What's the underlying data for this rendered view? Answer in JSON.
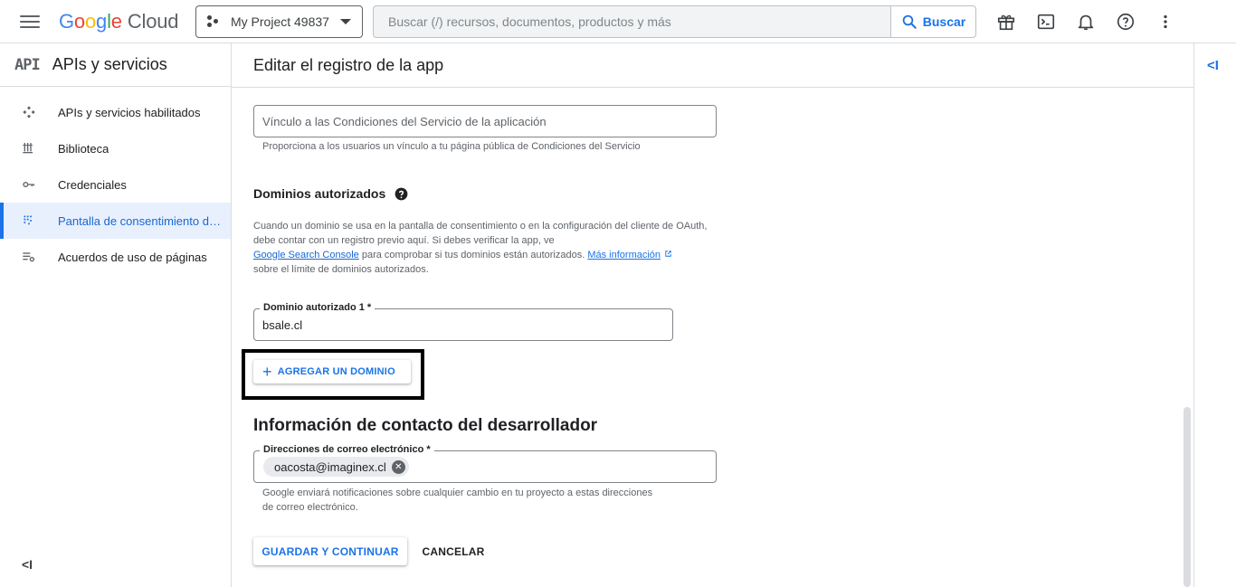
{
  "topbar": {
    "logo_letters": [
      "G",
      "o",
      "o",
      "g",
      "l",
      "e"
    ],
    "logo_suffix": "Cloud",
    "project_name": "My Project 49837",
    "search_placeholder": "Buscar (/) recursos, documentos, productos y más",
    "search_button": "Buscar",
    "icons": [
      "gift-icon",
      "terminal-icon",
      "bell-icon",
      "help-icon",
      "more-vert-icon"
    ]
  },
  "sidebar": {
    "logo_text": "API",
    "title": "APIs y servicios",
    "items": [
      {
        "label": "APIs y servicios habilitados",
        "icon": "apis-icon",
        "active": false
      },
      {
        "label": "Biblioteca",
        "icon": "library-icon",
        "active": false
      },
      {
        "label": "Credenciales",
        "icon": "key-icon",
        "active": false
      },
      {
        "label": "Pantalla de consentimiento de OAuth",
        "icon": "consent-icon",
        "active": true
      },
      {
        "label": "Acuerdos de uso de páginas",
        "icon": "agreements-icon",
        "active": false
      }
    ],
    "collapse_label": "<I"
  },
  "main": {
    "title": "Editar el registro de la app",
    "tos_placeholder": "Vínculo a las Condiciones del Servicio de la aplicación",
    "tos_hint": "Proporciona a los usuarios un vínculo a tu página pública de Condiciones del Servicio",
    "domains_title": "Dominios autorizados",
    "domains_para_1": "Cuando un dominio se usa en la pantalla de consentimiento o en la configuración del cliente de OAuth, debe contar con un registro previo aquí. Si debes verificar la app, ve",
    "domains_link_gsc": "Google Search Console",
    "domains_para_2": " para comprobar si tus dominios están autorizados. ",
    "domains_link_more": "Más información",
    "domains_para_3": "sobre el límite de dominios autorizados.",
    "domain1_label": "Dominio autorizado 1 *",
    "domain1_value": "bsale.cl",
    "add_domain_button": "AGREGAR UN DOMINIO",
    "contact_title": "Información de contacto del desarrollador",
    "email_label": "Direcciones de correo electrónico *",
    "email_chip": "oacosta@imaginex.cl",
    "email_hint_1": "Google enviará notificaciones sobre cualquier cambio en tu proyecto a estas direcciones",
    "email_hint_2": "de correo electrónico.",
    "save_button": "GUARDAR Y CONTINUAR",
    "cancel_button": "CANCELAR"
  },
  "rightpanel": {
    "toggle_label": "<I"
  },
  "colors": {
    "accent": "#1a73e8",
    "active_bg": "#e8f0fe",
    "border": "#dadce0"
  }
}
